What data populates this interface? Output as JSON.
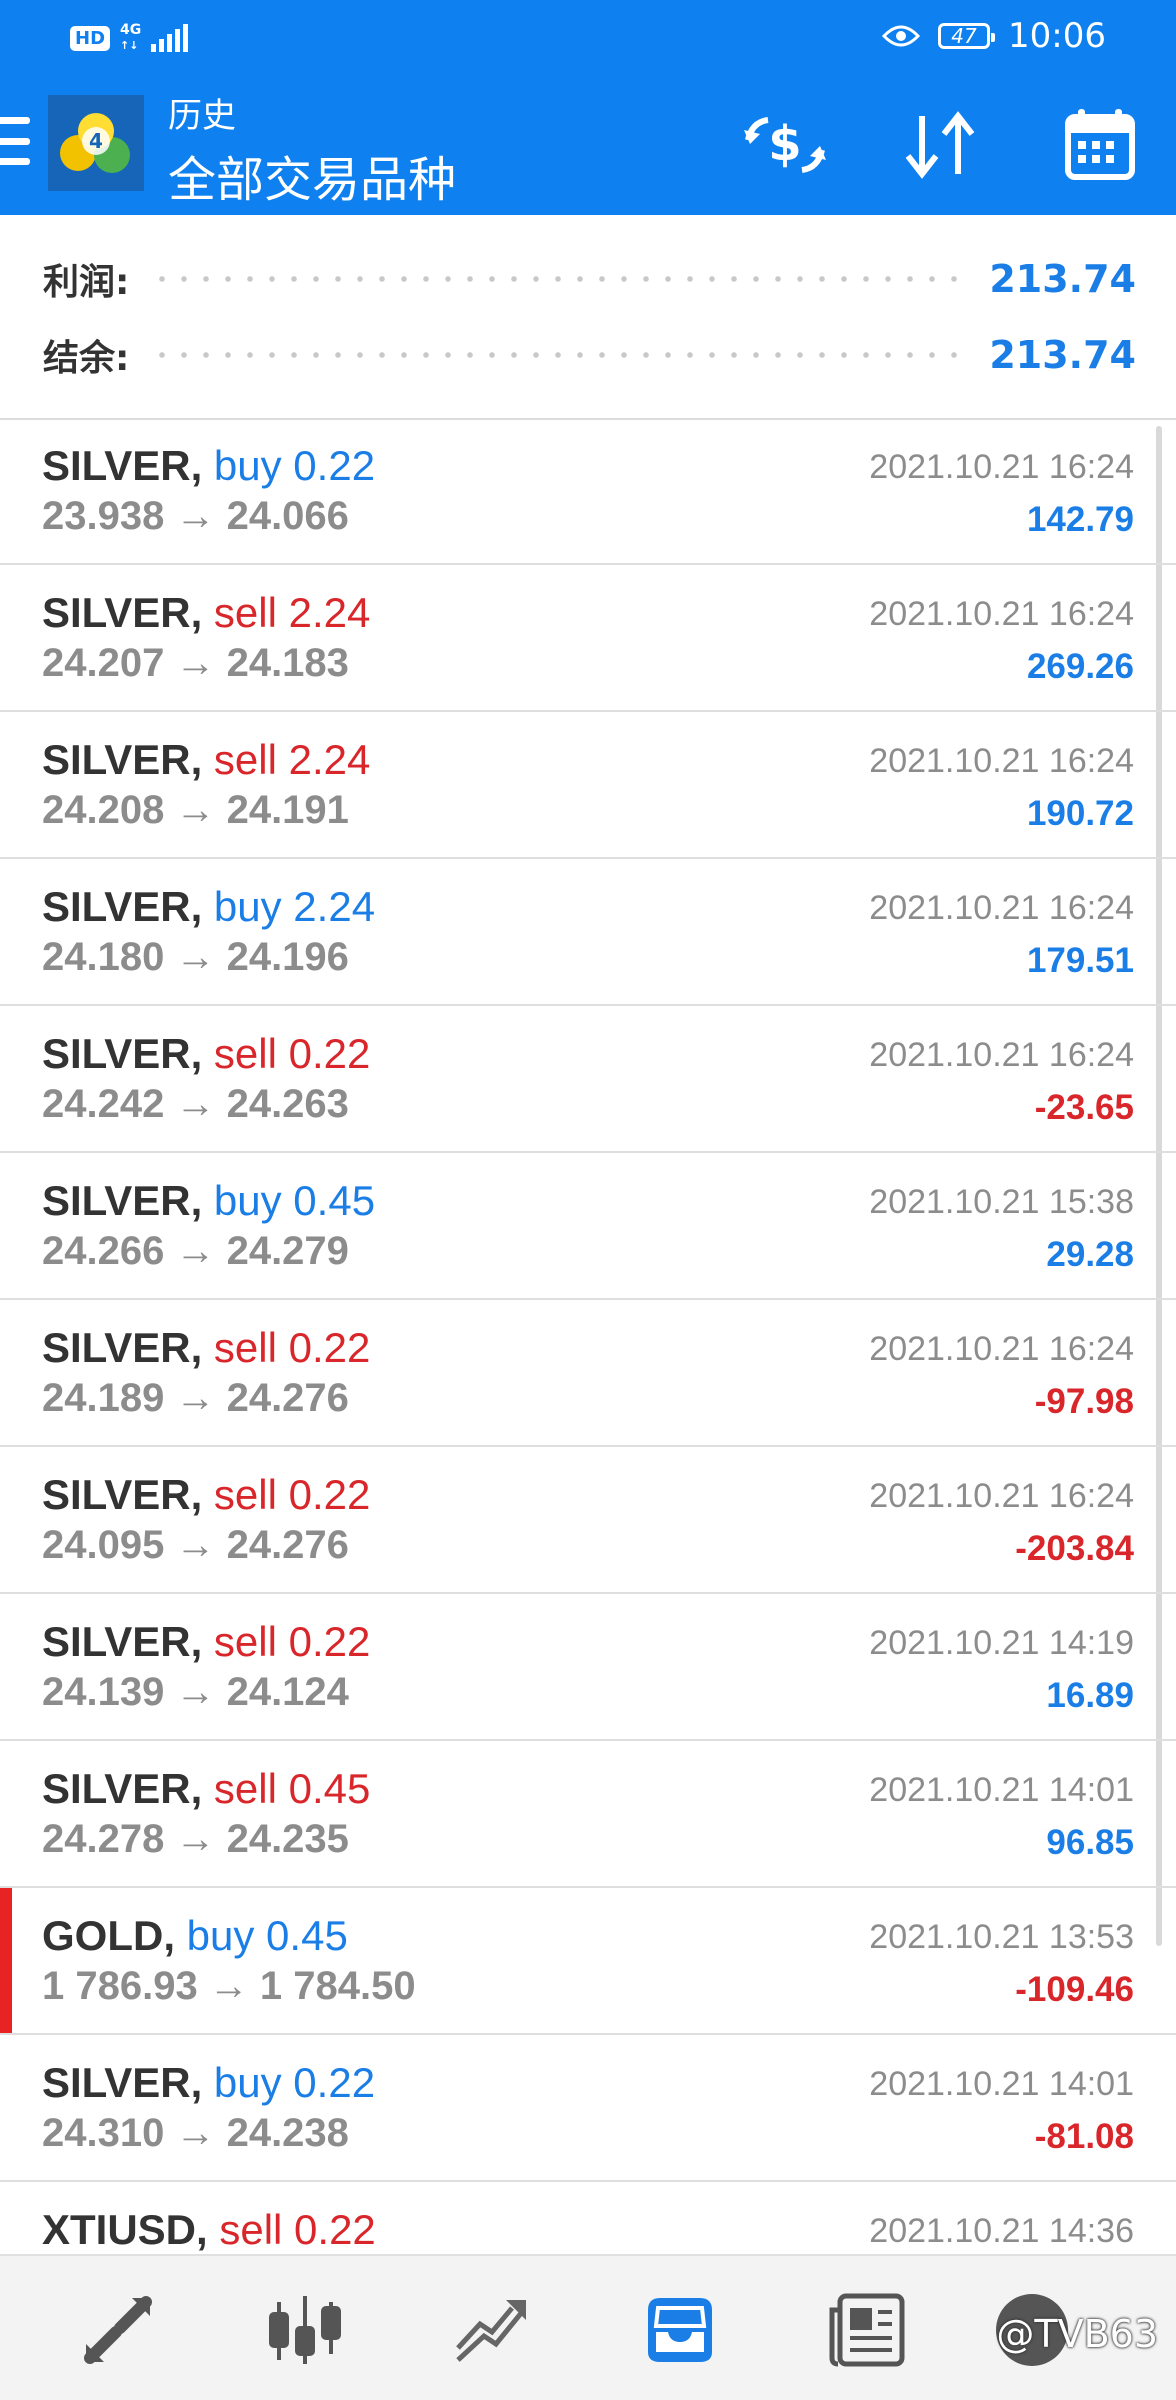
{
  "status_bar": {
    "hd": "HD",
    "network": "4G",
    "battery": "47",
    "time": "10:06"
  },
  "header": {
    "subtitle": "历史",
    "title": "全部交易品种",
    "icons": [
      "menu-icon",
      "mt4-logo",
      "currency-exchange-icon",
      "sort-icon",
      "calendar-icon"
    ]
  },
  "summary": {
    "profit_label": "利润:",
    "profit_value": "213.74",
    "balance_label": "结余:",
    "balance_value": "213.74"
  },
  "colors": {
    "header": "#0f80f0",
    "buy": "#1a7ee6",
    "sell": "#d9262a",
    "gray": "#8c8c8c"
  },
  "trades": [
    {
      "symbol": "SILVER,",
      "side": "buy 0.22",
      "type": "buy",
      "prices": "23.938 → 24.066",
      "time": "2021.10.21 16:24",
      "profit": "142.79"
    },
    {
      "symbol": "SILVER,",
      "side": "sell 2.24",
      "type": "sell",
      "prices": "24.207 → 24.183",
      "time": "2021.10.21 16:24",
      "profit": "269.26"
    },
    {
      "symbol": "SILVER,",
      "side": "sell 2.24",
      "type": "sell",
      "prices": "24.208 → 24.191",
      "time": "2021.10.21 16:24",
      "profit": "190.72"
    },
    {
      "symbol": "SILVER,",
      "side": "buy 2.24",
      "type": "buy",
      "prices": "24.180 → 24.196",
      "time": "2021.10.21 16:24",
      "profit": "179.51"
    },
    {
      "symbol": "SILVER,",
      "side": "sell 0.22",
      "type": "sell",
      "prices": "24.242 → 24.263",
      "time": "2021.10.21 16:24",
      "profit": "-23.65"
    },
    {
      "symbol": "SILVER,",
      "side": "buy 0.45",
      "type": "buy",
      "prices": "24.266 → 24.279",
      "time": "2021.10.21 15:38",
      "profit": "29.28"
    },
    {
      "symbol": "SILVER,",
      "side": "sell 0.22",
      "type": "sell",
      "prices": "24.189 → 24.276",
      "time": "2021.10.21 16:24",
      "profit": "-97.98"
    },
    {
      "symbol": "SILVER,",
      "side": "sell 0.22",
      "type": "sell",
      "prices": "24.095 → 24.276",
      "time": "2021.10.21 16:24",
      "profit": "-203.84"
    },
    {
      "symbol": "SILVER,",
      "side": "sell 0.22",
      "type": "sell",
      "prices": "24.139 → 24.124",
      "time": "2021.10.21 14:19",
      "profit": "16.89"
    },
    {
      "symbol": "SILVER,",
      "side": "sell 0.45",
      "type": "sell",
      "prices": "24.278 → 24.235",
      "time": "2021.10.21 14:01",
      "profit": "96.85"
    },
    {
      "symbol": "GOLD,",
      "side": "buy 0.45",
      "type": "buy",
      "prices": "1 786.93 → 1 784.50",
      "time": "2021.10.21 13:53",
      "profit": "-109.46",
      "selected": true
    },
    {
      "symbol": "SILVER,",
      "side": "buy 0.22",
      "type": "buy",
      "prices": "24.310 → 24.238",
      "time": "2021.10.21 14:01",
      "profit": "-81.08"
    },
    {
      "symbol": "XTIUSD,",
      "side": "sell 0.22",
      "type": "sell",
      "prices": "",
      "time": "2021.10.21 14:36",
      "profit": ""
    }
  ],
  "bottom_nav": {
    "items": [
      "quotes-icon",
      "chart-icon",
      "trade-icon",
      "history-icon",
      "news-icon",
      "messages-icon"
    ],
    "active": "history-icon",
    "watermark": "@TVB63"
  }
}
